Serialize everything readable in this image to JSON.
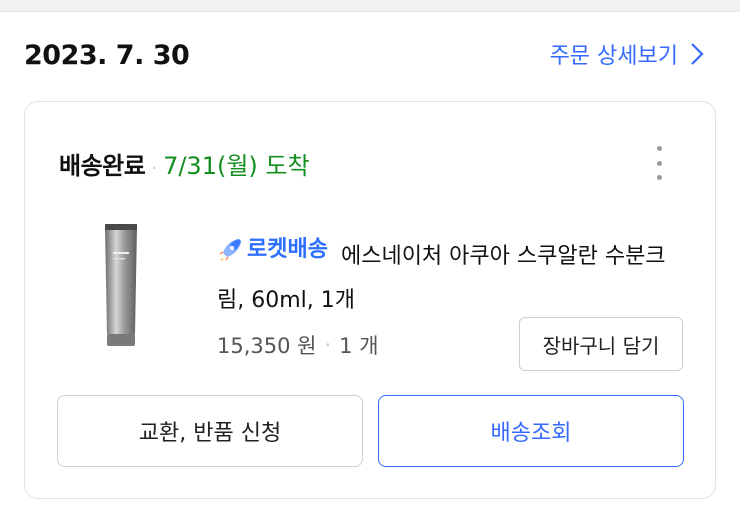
{
  "order": {
    "date": "2023. 7. 30",
    "detail_link_label": "주문 상세보기"
  },
  "delivery": {
    "status": "배송완료",
    "separator": "·",
    "arrival": "7/31(월) 도착"
  },
  "product": {
    "badge_label": "로켓배송",
    "title": "에스네이처 아쿠아 스쿠알란 수분크림, 60ml, 1개",
    "price": "15,350 원",
    "separator": "·",
    "quantity": "1 개",
    "thumbnail_icon": "cream-tube-image",
    "badge_icon": "rocket-icon"
  },
  "buttons": {
    "add_to_cart": "장바구니 담기",
    "exchange_return": "교환, 반품 신청",
    "track_delivery": "배송조회"
  },
  "colors": {
    "link_blue": "#346aff",
    "arrival_green": "#138f1f",
    "rocket_blue": "#2c6fff"
  }
}
